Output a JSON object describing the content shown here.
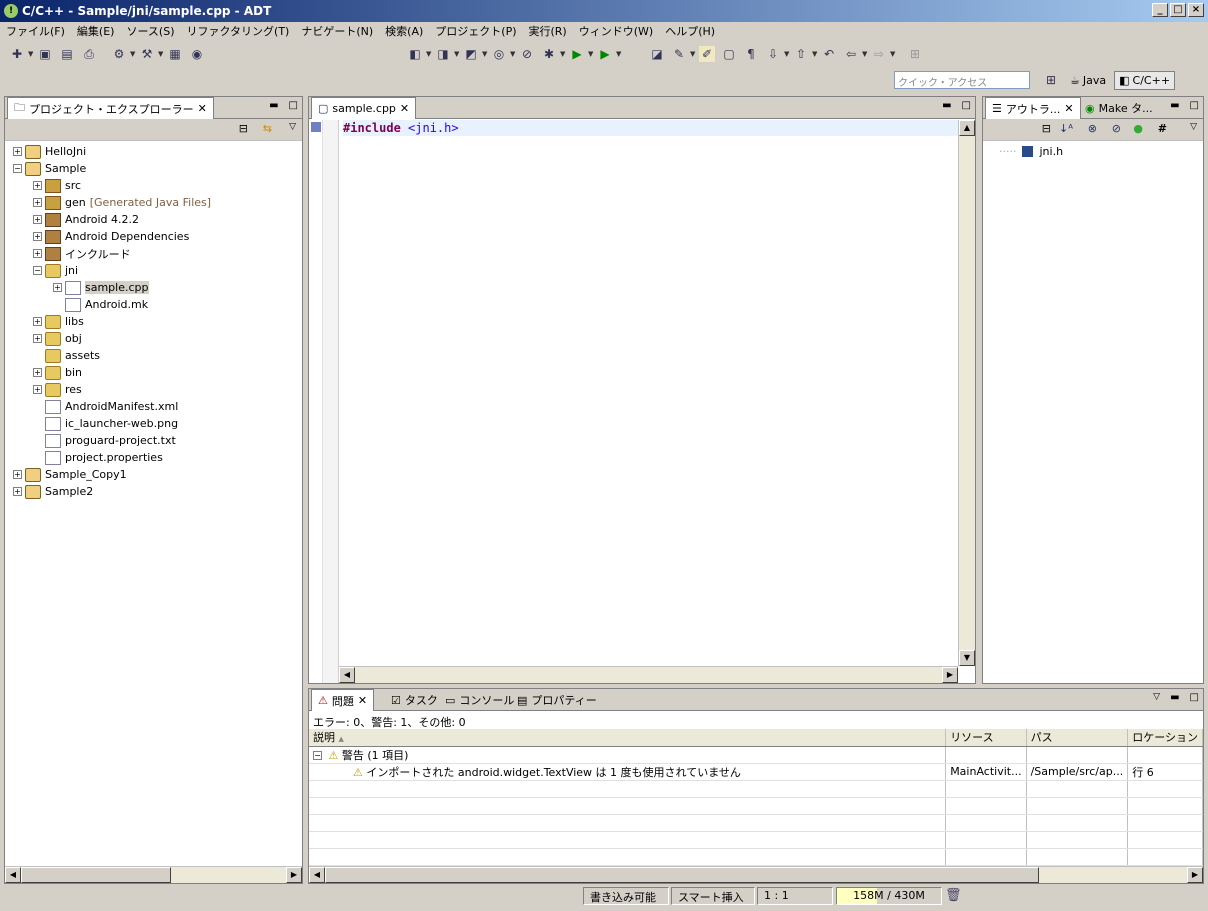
{
  "window": {
    "title": "C/C++ - Sample/jni/sample.cpp - ADT"
  },
  "menu": [
    "ファイル(F)",
    "編集(E)",
    "ソース(S)",
    "リファクタリング(T)",
    "ナビゲート(N)",
    "検索(A)",
    "プロジェクト(P)",
    "実行(R)",
    "ウィンドウ(W)",
    "ヘルプ(H)"
  ],
  "quick_access": {
    "placeholder": "クイック・アクセス"
  },
  "perspectives": [
    {
      "label": "Java"
    },
    {
      "label": "C/C++",
      "active": true
    }
  ],
  "explorer": {
    "tab": "プロジェクト・エクスプローラー",
    "tree": [
      {
        "label": "HelloJni",
        "depth": 0,
        "exp": "+",
        "icon": "proj"
      },
      {
        "label": "Sample",
        "depth": 0,
        "exp": "-",
        "icon": "proj"
      },
      {
        "label": "src",
        "depth": 1,
        "exp": "+",
        "icon": "pkg"
      },
      {
        "label": "gen",
        "tag": "[Generated Java Files]",
        "depth": 1,
        "exp": "+",
        "icon": "pkg"
      },
      {
        "label": "Android 4.2.2",
        "depth": 1,
        "exp": "+",
        "icon": "lib"
      },
      {
        "label": "Android Dependencies",
        "depth": 1,
        "exp": "+",
        "icon": "lib"
      },
      {
        "label": "インクルード",
        "depth": 1,
        "exp": "+",
        "icon": "lib"
      },
      {
        "label": "jni",
        "depth": 1,
        "exp": "-",
        "icon": "folder"
      },
      {
        "label": "sample.cpp",
        "depth": 2,
        "exp": "+",
        "icon": "file",
        "selected": true
      },
      {
        "label": "Android.mk",
        "depth": 2,
        "exp": "",
        "icon": "file"
      },
      {
        "label": "libs",
        "depth": 1,
        "exp": "+",
        "icon": "folder"
      },
      {
        "label": "obj",
        "depth": 1,
        "exp": "+",
        "icon": "folder"
      },
      {
        "label": "assets",
        "depth": 1,
        "exp": "",
        "icon": "folder"
      },
      {
        "label": "bin",
        "depth": 1,
        "exp": "+",
        "icon": "folder"
      },
      {
        "label": "res",
        "depth": 1,
        "exp": "+",
        "icon": "folder"
      },
      {
        "label": "AndroidManifest.xml",
        "depth": 1,
        "exp": "",
        "icon": "file"
      },
      {
        "label": "ic_launcher-web.png",
        "depth": 1,
        "exp": "",
        "icon": "file"
      },
      {
        "label": "proguard-project.txt",
        "depth": 1,
        "exp": "",
        "icon": "file"
      },
      {
        "label": "project.properties",
        "depth": 1,
        "exp": "",
        "icon": "file"
      },
      {
        "label": "Sample_Copy1",
        "depth": 0,
        "exp": "+",
        "icon": "proj"
      },
      {
        "label": "Sample2",
        "depth": 0,
        "exp": "+",
        "icon": "proj"
      }
    ]
  },
  "editor": {
    "tab": "sample.cpp",
    "directive": "#include",
    "header": "<jni.h>"
  },
  "outline": {
    "tab": "アウトラ...",
    "tab2": "Make タ...",
    "item": "jni.h"
  },
  "problems": {
    "tabs": [
      "問題",
      "タスク",
      "コンソール",
      "プロパティー"
    ],
    "summary": "エラー: 0、警告: 1、その他: 0",
    "columns": [
      "説明",
      "リソース",
      "パス",
      "ロケーション"
    ],
    "group": "警告 (1 項目)",
    "row": {
      "desc": "インポートされた android.widget.TextView は 1 度も使用されていません",
      "resource": "MainActivit...",
      "path": "/Sample/src/ap...",
      "loc": "行 6"
    }
  },
  "status": {
    "writable": "書き込み可能",
    "insert": "スマート挿入",
    "pos": "1 : 1",
    "memory": "158M / 430M"
  }
}
